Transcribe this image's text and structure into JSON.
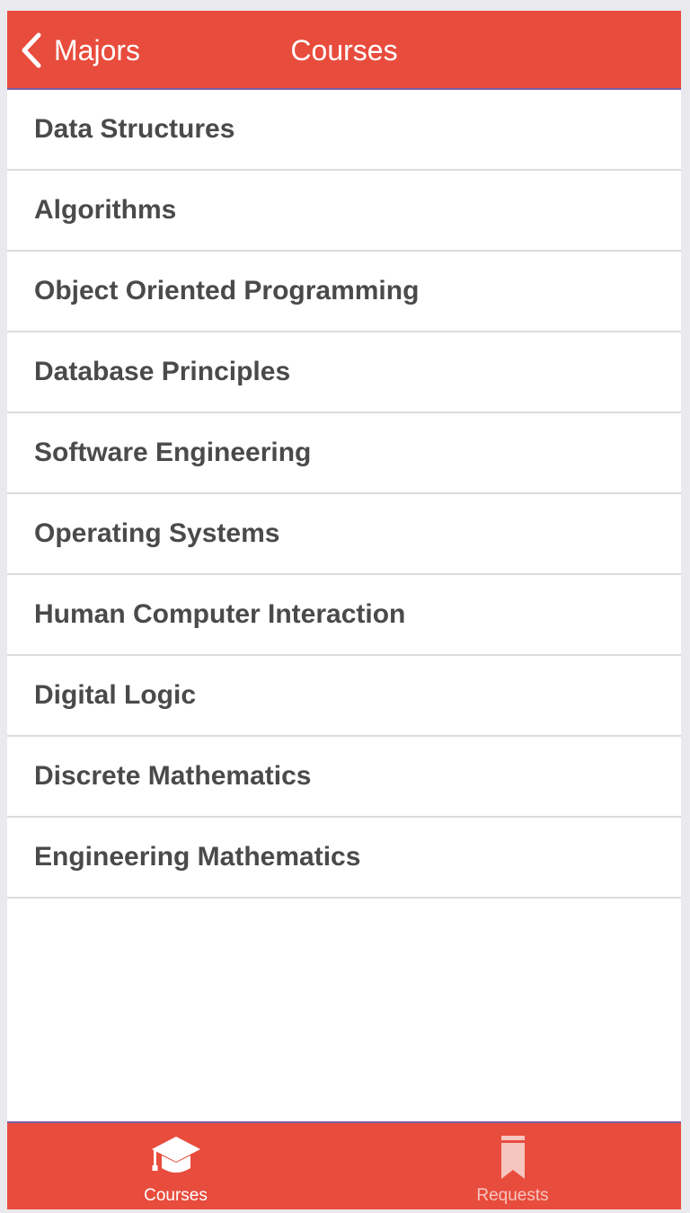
{
  "navbar": {
    "back_label": "Majors",
    "title": "Courses",
    "back_icon": "chevron-left-icon"
  },
  "courses": [
    "Data Structures",
    "Algorithms",
    "Object Oriented Programming",
    "Database Principles",
    "Software Engineering",
    "Operating Systems",
    "Human Computer Interaction",
    "Digital Logic",
    "Discrete Mathematics",
    "Engineering Mathematics"
  ],
  "tabbar": {
    "tabs": [
      {
        "label": "Courses",
        "icon": "graduation-cap-icon",
        "active": true
      },
      {
        "label": "Requests",
        "icon": "bookmark-icon",
        "active": false
      }
    ]
  },
  "colors": {
    "accent": "#e84c3d",
    "divider": "#7b5fa6",
    "text": "#4a4a4a",
    "inactive_tab": "#f7c5bf"
  }
}
